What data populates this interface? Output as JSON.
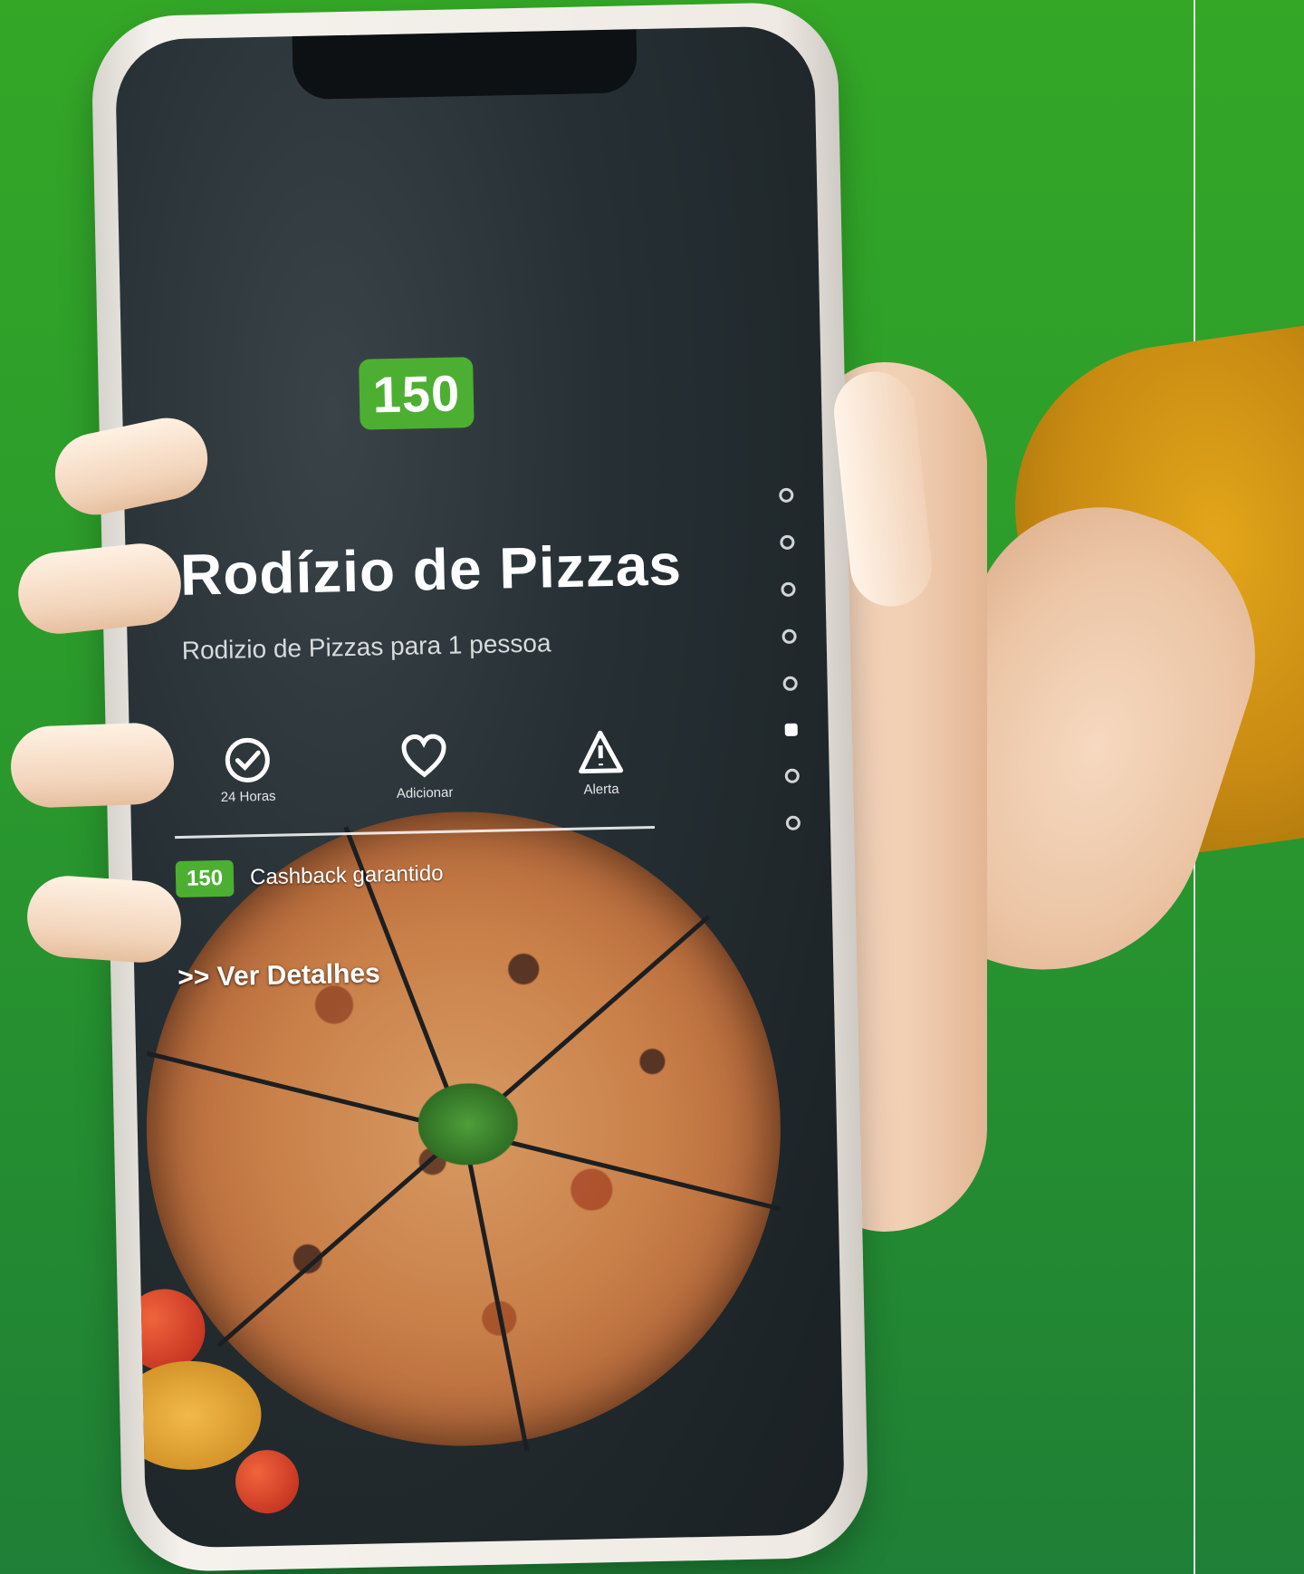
{
  "product": {
    "price_badge": "150",
    "title": "Rodízio de Pizzas",
    "subtitle": "Rodizio de Pizzas para 1 pessoa"
  },
  "stats": [
    {
      "icon": "check-badge-icon",
      "label": "24 Horas"
    },
    {
      "icon": "heart-icon",
      "label": "Adicionar"
    },
    {
      "icon": "warning-icon",
      "label": "Alerta"
    }
  ],
  "promo": {
    "badge": "150",
    "text": "Cashback garantido"
  },
  "details_link": ">> Ver Detalhes",
  "pager": {
    "count": 8,
    "active_index": 5
  },
  "colors": {
    "background_green": "#2a9a2c",
    "accent_green": "#4caf31",
    "screen_dark": "#263034"
  }
}
